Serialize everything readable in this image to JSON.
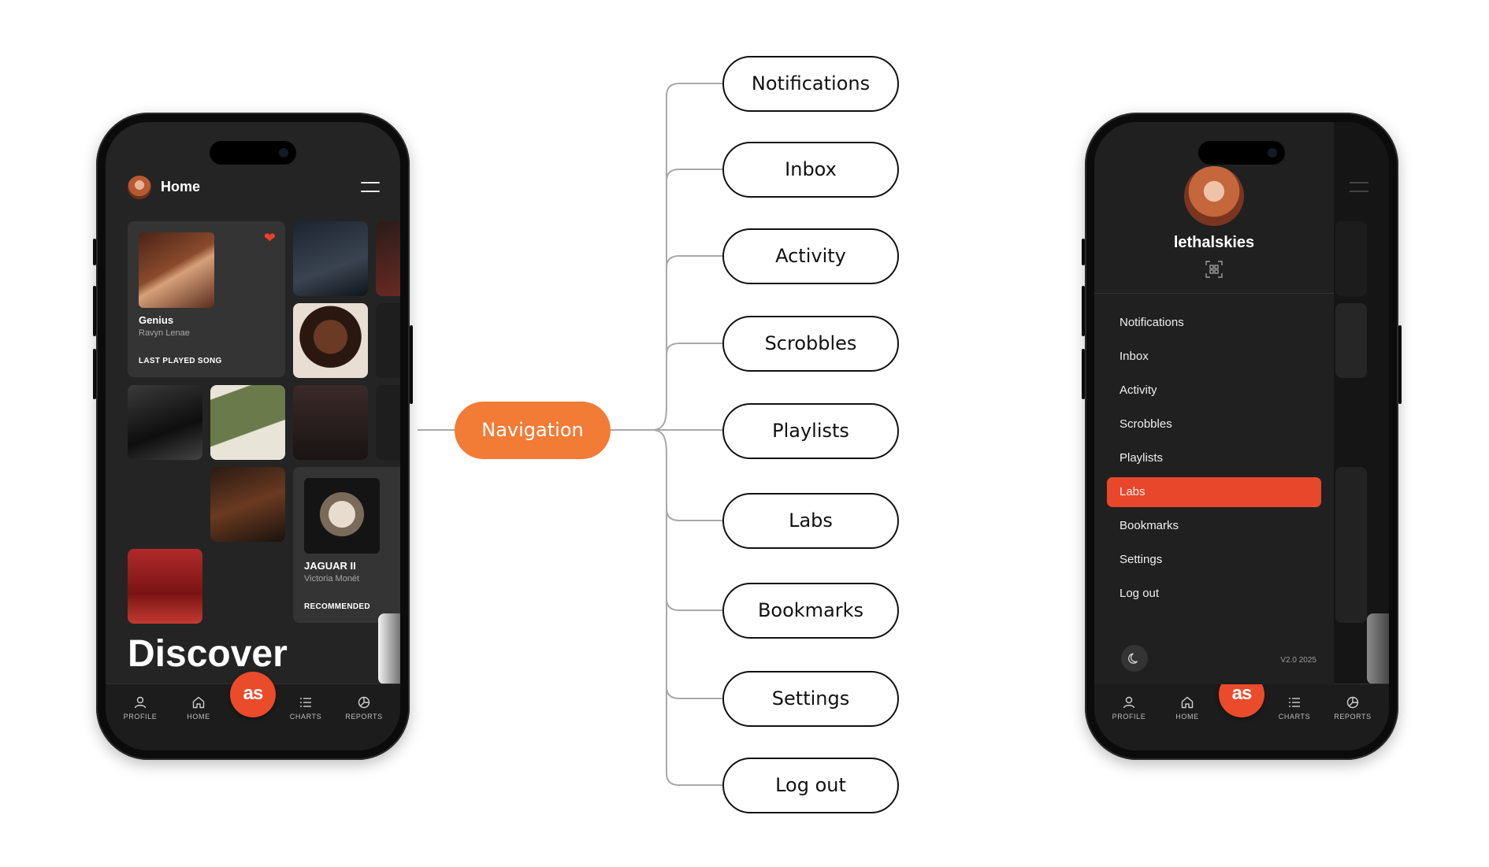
{
  "diagram": {
    "root": "Navigation",
    "leaves": [
      "Notifications",
      "Inbox",
      "Activity",
      "Scrobbles",
      "Playlists",
      "Labs",
      "Bookmarks",
      "Settings",
      "Log out"
    ]
  },
  "left_phone": {
    "header": {
      "title": "Home",
      "avatar": "profile-avatar",
      "menu_icon": "hamburger-icon"
    },
    "cards": {
      "last_played": {
        "title": "Genius",
        "artist": "Ravyn Lenae",
        "tag": "LAST PLAYED SONG",
        "liked": true
      },
      "recommended": {
        "title": "JAGUAR II",
        "artist": "Victoria Monét",
        "tag": "RECOMMENDED"
      }
    },
    "discover_heading": "Discover"
  },
  "right_phone": {
    "profile": {
      "username": "lethalskies",
      "qr_icon": "qr-scan-icon"
    },
    "menu": [
      "Notifications",
      "Inbox",
      "Activity",
      "Scrobbles",
      "Playlists",
      "Labs",
      "Bookmarks",
      "Settings",
      "Log out"
    ],
    "active_item": "Labs",
    "version": "V2.0 2025",
    "theme_icon": "moon-icon"
  },
  "bottom_nav": {
    "items": [
      {
        "label": "PROFILE",
        "icon": "user-icon"
      },
      {
        "label": "HOME",
        "icon": "home-icon"
      },
      {
        "label": "CHARTS",
        "icon": "list-icon"
      },
      {
        "label": "REPORTS",
        "icon": "pie-chart-icon"
      }
    ],
    "center_logo": "as"
  },
  "colors": {
    "accent": "#ea4b2a",
    "diagram_accent": "#f27b36",
    "screen": "#242424"
  }
}
